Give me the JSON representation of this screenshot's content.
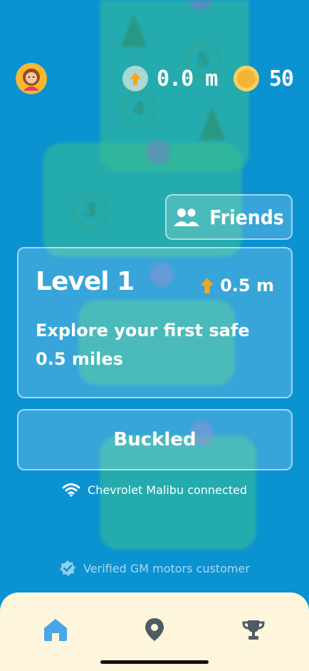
{
  "topbar": {
    "distance": "0.0 m",
    "coins": "50"
  },
  "friends_label": "Friends",
  "level": {
    "title": "Level 1",
    "distance": "0.5 m",
    "description": "Explore your first safe 0.5 miles"
  },
  "status_button": "Buckled",
  "connection": {
    "text": "Chevrolet Malibu connected",
    "icon": "wifi-icon"
  },
  "verified": {
    "text": "Verified GM motors customer",
    "icon": "verified-badge-icon"
  },
  "nav": {
    "items": [
      {
        "name": "home",
        "icon": "home-icon",
        "active": true
      },
      {
        "name": "map",
        "icon": "location-pin-icon",
        "active": false
      },
      {
        "name": "trophies",
        "icon": "trophy-icon",
        "active": false
      }
    ],
    "active_color": "#4aa6e8",
    "inactive_color": "#4f5b63"
  },
  "colors": {
    "background": "#0b92d1",
    "accent_orange": "#f3a624",
    "navbar_bg": "#fdf5dc"
  }
}
